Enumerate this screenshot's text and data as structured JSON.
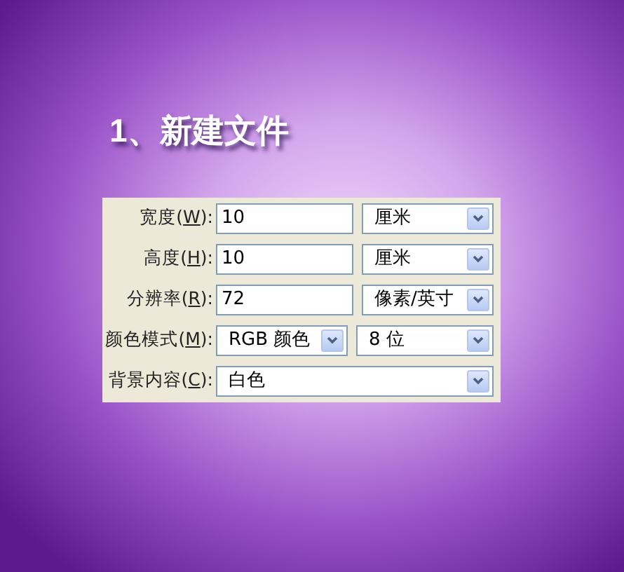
{
  "heading": "1、新建文件",
  "rows": [
    {
      "label_before": "宽度(",
      "access_key": "W",
      "label_after": "):",
      "controls": [
        {
          "kind": "text",
          "value": "10"
        },
        {
          "kind": "select",
          "value": "厘米"
        }
      ]
    },
    {
      "label_before": "高度(",
      "access_key": "H",
      "label_after": "):",
      "controls": [
        {
          "kind": "text",
          "value": "10"
        },
        {
          "kind": "select",
          "value": "厘米"
        }
      ]
    },
    {
      "label_before": "分辨率(",
      "access_key": "R",
      "label_after": "):",
      "controls": [
        {
          "kind": "text",
          "value": "72"
        },
        {
          "kind": "select",
          "value": "像素/英寸"
        }
      ]
    },
    {
      "label_before": "颜色模式(",
      "access_key": "M",
      "label_after": "):",
      "controls": [
        {
          "kind": "select",
          "value": "RGB 颜色"
        },
        {
          "kind": "select",
          "value": "8 位"
        }
      ]
    },
    {
      "label_before": "背景内容(",
      "access_key": "C",
      "label_after": "):",
      "controls": [
        {
          "kind": "select",
          "value": "白色"
        }
      ]
    }
  ]
}
